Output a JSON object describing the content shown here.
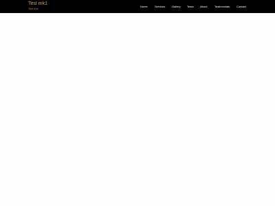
{
  "header": {
    "brand": {
      "title": "Test mk1",
      "subtitle": "Test line"
    },
    "nav": [
      {
        "label": "Home"
      },
      {
        "label": "Services"
      },
      {
        "label": "Gallery"
      },
      {
        "label": "Tears"
      },
      {
        "label": "About"
      },
      {
        "label": "Testimonials"
      },
      {
        "label": "Contact"
      }
    ]
  },
  "colors": {
    "topbar_background": "#000000",
    "brand_accent": "#d89a55",
    "page_background": "#fdfdfd"
  }
}
